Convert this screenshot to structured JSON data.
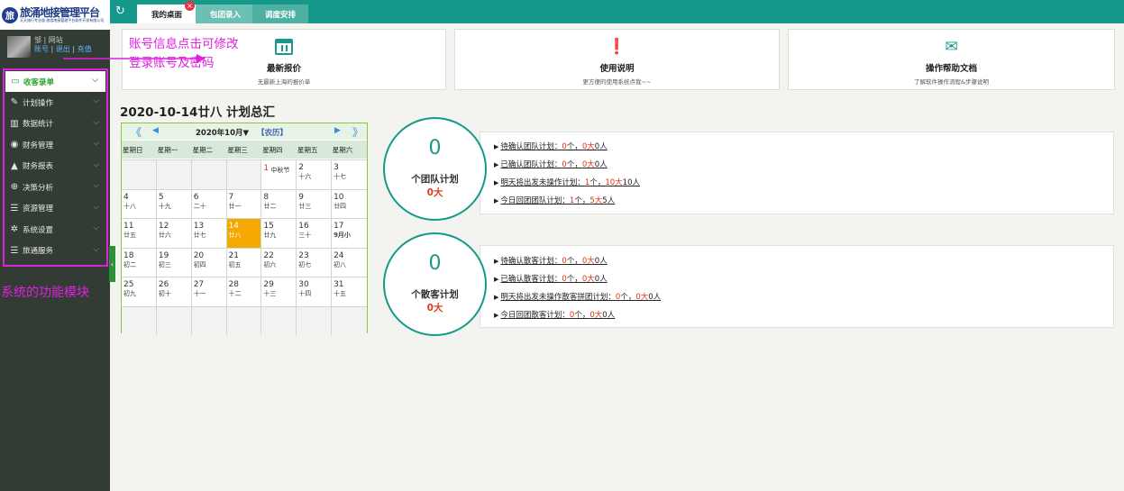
{
  "logo": {
    "badge": "旅",
    "title": "旅涌地接管理平台",
    "subtitle": "天天旅行专业版·旅游地接管理平台软件开发有限公司"
  },
  "user": {
    "line1": "邹 | 网站",
    "account_link": "账号",
    "logout_link": "退出",
    "recharge_link": "充值",
    "sep": "|"
  },
  "menu": [
    {
      "label": "收客录单",
      "icon": "monitor-icon",
      "glyph": "▭"
    },
    {
      "label": "计划操作",
      "icon": "edit-icon",
      "glyph": "✎"
    },
    {
      "label": "数据统计",
      "icon": "bar-chart-icon",
      "glyph": "▥"
    },
    {
      "label": "财务管理",
      "icon": "coins-icon",
      "glyph": "◉"
    },
    {
      "label": "财务报表",
      "icon": "report-icon",
      "glyph": "▲"
    },
    {
      "label": "决策分析",
      "icon": "globe-icon",
      "glyph": "⊕"
    },
    {
      "label": "资源管理",
      "icon": "list-icon",
      "glyph": "☰"
    },
    {
      "label": "系统设置",
      "icon": "gear-icon",
      "glyph": "✲"
    },
    {
      "label": "旅通服务",
      "icon": "list-icon",
      "glyph": "☰"
    }
  ],
  "annotations": {
    "module_label": "系统的功能模块",
    "account_tip_line1": "账号信息点击可修改",
    "account_tip_line2": "登录账号及密码"
  },
  "tabs": [
    {
      "label": "我的桌面"
    },
    {
      "label": "包团录入"
    },
    {
      "label": "调度安排"
    }
  ],
  "tab_close": "×",
  "refresh_glyph": "↻",
  "cards": [
    {
      "title": "最新报价",
      "subtitle": "无最新上海的报价单",
      "icon": "calendar-icon"
    },
    {
      "title": "使用说明",
      "subtitle": "更方便的使用系统点我~~",
      "icon": "chat-alert-icon",
      "glyph": "❗"
    },
    {
      "title": "操作帮助文档",
      "subtitle": "了解软件操作流程&步骤说明",
      "icon": "help-doc-icon",
      "glyph": "✉"
    }
  ],
  "summary_title": "2020-10-14廿八 计划总汇",
  "calendar": {
    "year_month": "2020年10月▼",
    "lunar_toggle": "【农历】",
    "prev_year": "《",
    "prev_month": "◀",
    "next_month": "▶",
    "next_year": "》",
    "weekdays": [
      "星期日",
      "星期一",
      "星期二",
      "星期三",
      "星期四",
      "星期五",
      "星期六"
    ],
    "weeks": [
      [
        {
          "d": "",
          "l": ""
        },
        {
          "d": "",
          "l": ""
        },
        {
          "d": "",
          "l": ""
        },
        {
          "d": "",
          "l": ""
        },
        {
          "d": "1",
          "l": "中秋节",
          "hol": true
        },
        {
          "d": "2",
          "l": "十六"
        },
        {
          "d": "3",
          "l": "十七"
        }
      ],
      [
        {
          "d": "4",
          "l": "十八"
        },
        {
          "d": "5",
          "l": "十九"
        },
        {
          "d": "6",
          "l": "二十"
        },
        {
          "d": "7",
          "l": "廿一"
        },
        {
          "d": "8",
          "l": "廿二"
        },
        {
          "d": "9",
          "l": "廿三"
        },
        {
          "d": "10",
          "l": "廿四"
        }
      ],
      [
        {
          "d": "11",
          "l": "廿五"
        },
        {
          "d": "12",
          "l": "廿六"
        },
        {
          "d": "13",
          "l": "廿七"
        },
        {
          "d": "14",
          "l": "廿八",
          "today": true
        },
        {
          "d": "15",
          "l": "廿九"
        },
        {
          "d": "16",
          "l": "三十"
        },
        {
          "d": "17",
          "l": "9月小",
          "bold": true
        }
      ],
      [
        {
          "d": "18",
          "l": "初二"
        },
        {
          "d": "19",
          "l": "初三"
        },
        {
          "d": "20",
          "l": "初四"
        },
        {
          "d": "21",
          "l": "初五"
        },
        {
          "d": "22",
          "l": "初六"
        },
        {
          "d": "23",
          "l": "初七"
        },
        {
          "d": "24",
          "l": "初八"
        }
      ],
      [
        {
          "d": "25",
          "l": "初九"
        },
        {
          "d": "26",
          "l": "初十"
        },
        {
          "d": "27",
          "l": "十一"
        },
        {
          "d": "28",
          "l": "十二"
        },
        {
          "d": "29",
          "l": "十三"
        },
        {
          "d": "30",
          "l": "十四"
        },
        {
          "d": "31",
          "l": "十五"
        }
      ],
      [
        {
          "d": "",
          "l": ""
        },
        {
          "d": "",
          "l": ""
        },
        {
          "d": "",
          "l": ""
        },
        {
          "d": "",
          "l": ""
        },
        {
          "d": "",
          "l": ""
        },
        {
          "d": "",
          "l": ""
        },
        {
          "d": "",
          "l": ""
        }
      ]
    ]
  },
  "team_plan": {
    "count": "0",
    "label": "个团队计划",
    "adults": "0大",
    "items": [
      {
        "prefix": "待确认团队计划：",
        "n1": "0",
        "u1": "个，",
        "n2": "0大",
        "n3": "0",
        "u3": "人"
      },
      {
        "prefix": "已确认团队计划：",
        "n1": "0",
        "u1": "个，",
        "n2": "0大",
        "n3": "0",
        "u3": "人"
      },
      {
        "prefix": "明天将出发未操作计划：",
        "n1": "1",
        "u1": "个，",
        "n2": "10大",
        "n3": "10",
        "u3": "人"
      },
      {
        "prefix": "今日回团团队计划：",
        "n1": "1",
        "u1": "个，",
        "n2": "5大",
        "n3": "5",
        "u3": "人"
      }
    ]
  },
  "fit_plan": {
    "count": "0",
    "label": "个散客计划",
    "adults": "0大",
    "items": [
      {
        "prefix": "待确认散客计划：",
        "n1": "0",
        "u1": "个，",
        "n2": "0大",
        "n3": "0",
        "u3": "人"
      },
      {
        "prefix": "已确认散客计划：",
        "n1": "0",
        "u1": "个，",
        "n2": "0大",
        "n3": "0",
        "u3": "人"
      },
      {
        "prefix": "明天将出发未操作散客拼团计划：",
        "n1": "0",
        "u1": "个，",
        "n2": "0大",
        "n3": "0",
        "u3": "人"
      },
      {
        "prefix": "今日回团散客计划：",
        "n1": "0",
        "u1": "个，",
        "n2": "0大",
        "n3": "0",
        "u3": "人"
      }
    ]
  },
  "colors": {
    "accent": "#16998a",
    "annotation": "#e020e0",
    "today": "#f5a800",
    "highlight": "#e03010"
  }
}
